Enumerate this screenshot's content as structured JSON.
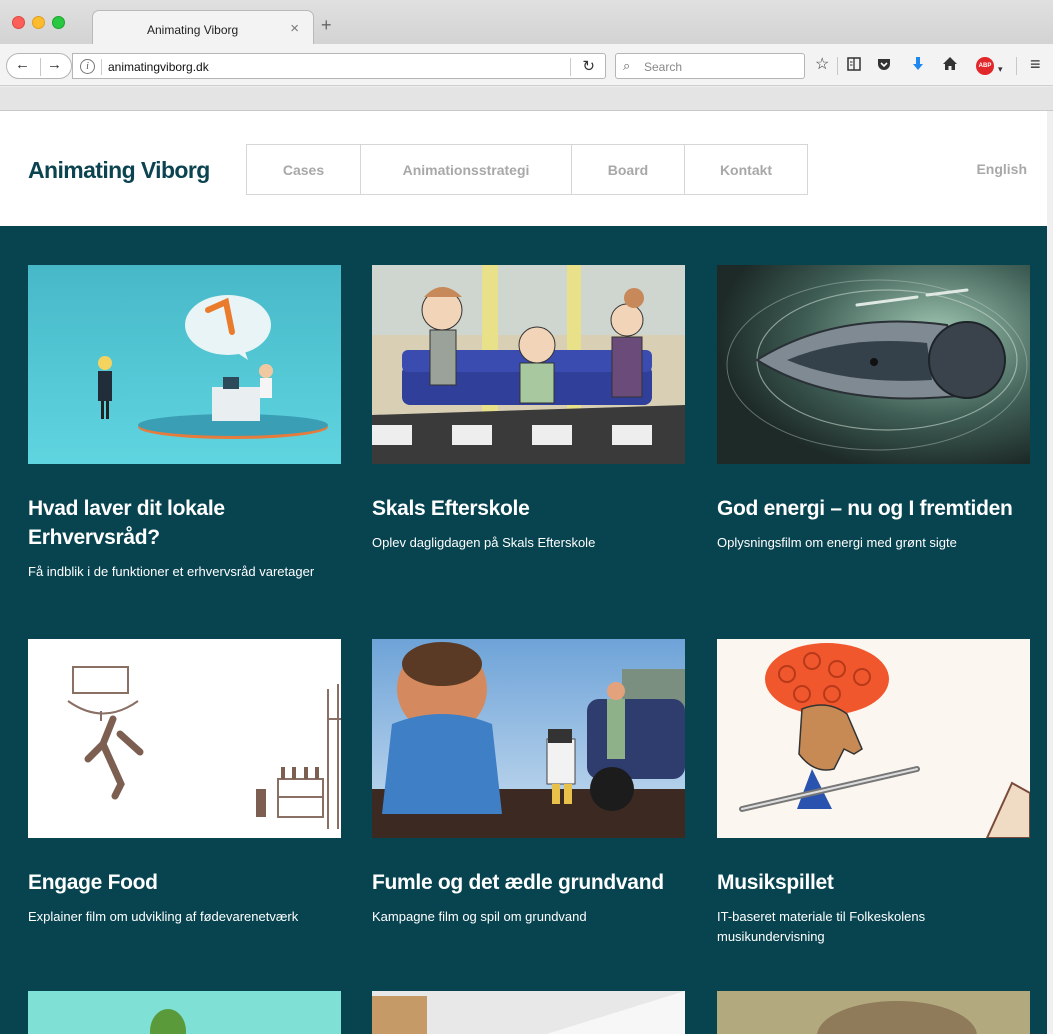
{
  "browser": {
    "tab_title": "Animating Viborg",
    "tab_close": "×",
    "new_tab": "+",
    "url": "animatingviborg.dk",
    "search_placeholder": "Search",
    "icons": [
      "back-icon",
      "forward-icon",
      "info-icon",
      "reload-icon",
      "search-icon",
      "bookmark-star-icon",
      "reading-list-icon",
      "pocket-icon",
      "download-icon",
      "home-icon",
      "adblock-icon",
      "menu-icon"
    ],
    "abp_label": "ABP"
  },
  "site": {
    "logo": "Animating Viborg",
    "nav": [
      {
        "label": "Cases"
      },
      {
        "label": "Animationsstrategi"
      },
      {
        "label": "Board"
      },
      {
        "label": "Kontakt"
      }
    ],
    "language": "English",
    "colors": {
      "header_bg": "#ffffff",
      "page_bg": "#074450",
      "logo": "#0b4450",
      "nav_text": "#a8a8a8"
    }
  },
  "cases": [
    {
      "title": "Hvad laver dit lokale Erhvervsråd?",
      "desc": "Få indblik i de funktioner et erhvervsråd varetager"
    },
    {
      "title": "Skals Efterskole",
      "desc": "Oplev dagligdagen på Skals Efterskole"
    },
    {
      "title": "God energi – nu og I fremtiden",
      "desc": "Oplysningsfilm om energi med grønt sigte"
    },
    {
      "title": "Engage Food",
      "desc": "Explainer film om udvikling af fødevarenetværk"
    },
    {
      "title": "Fumle og det ædle grundvand",
      "desc": "Kampagne film og spil om grundvand"
    },
    {
      "title": "Musikspillet",
      "desc": "IT-baseret materiale til Folkeskolens musikundervisning"
    }
  ]
}
